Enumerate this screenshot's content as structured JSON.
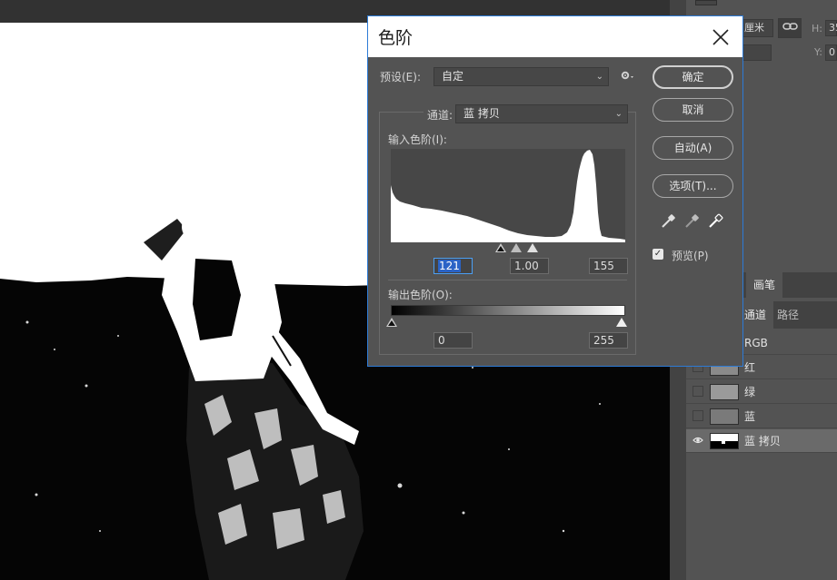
{
  "dialog": {
    "title": "色阶",
    "preset_label": "预设(E):",
    "preset_value": "自定",
    "channel_label": "通道:",
    "channel_value": "蓝 拷贝",
    "input_levels_label": "输入色阶(I):",
    "input_black": "121",
    "input_gamma": "1.00",
    "input_white": "155",
    "output_levels_label": "输出色阶(O):",
    "output_black": "0",
    "output_white": "255",
    "buttons": {
      "ok": "确定",
      "cancel": "取消",
      "auto": "自动(A)",
      "options": "选项(T)..."
    },
    "preview_label": "预览(P)",
    "preview_checked": true
  },
  "properties_panel": {
    "unit": "厘米",
    "h_label": "H:",
    "h_value": "35",
    "y_label": "Y:",
    "y_value": "0"
  },
  "panel_tabs_top": [
    {
      "label": "画笔"
    }
  ],
  "panel_tabs": [
    {
      "label": "通道",
      "active": true
    },
    {
      "label": "路径",
      "active": false
    }
  ],
  "channels": [
    {
      "label": "RGB",
      "visible": false,
      "selected": false
    },
    {
      "label": "红",
      "visible": false,
      "selected": false
    },
    {
      "label": "绿",
      "visible": false,
      "selected": false
    },
    {
      "label": "蓝",
      "visible": false,
      "selected": false
    },
    {
      "label": "蓝 拷贝",
      "visible": true,
      "selected": true
    }
  ],
  "colors": {
    "accent_blue": "#2d7bd6",
    "panel_bg": "#535353",
    "dark_bg": "#323232"
  }
}
